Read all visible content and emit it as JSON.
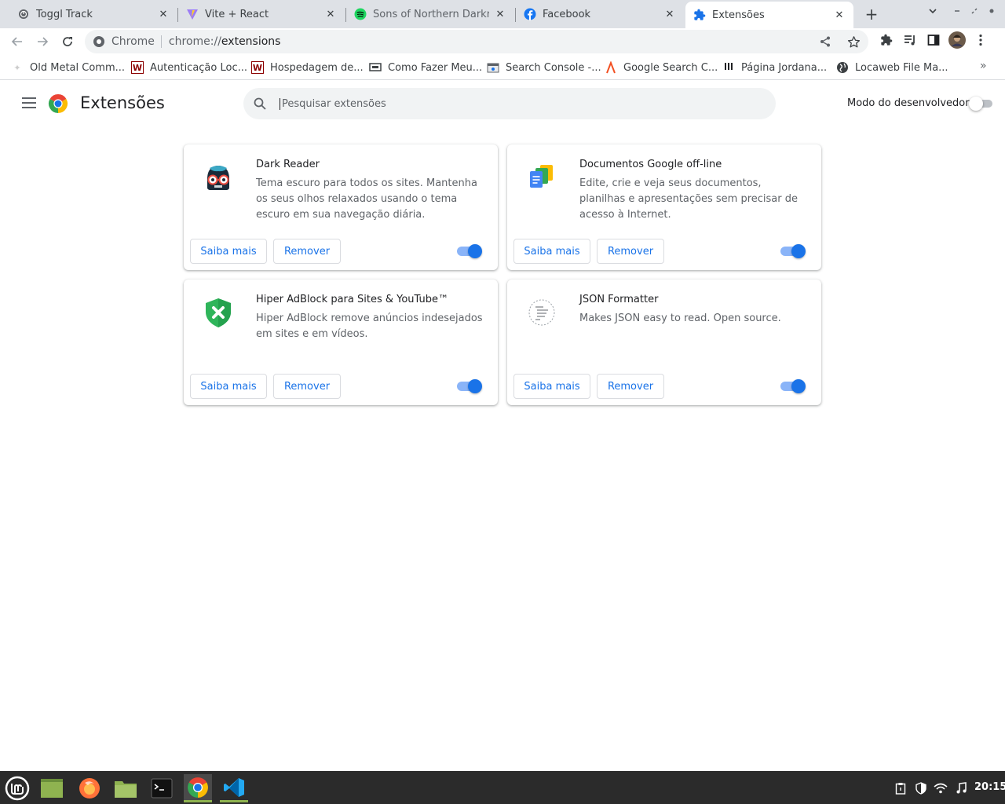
{
  "tabs": [
    {
      "title": "Toggl Track",
      "icon": "toggl-icon"
    },
    {
      "title": "Vite + React",
      "icon": "vite-icon"
    },
    {
      "title": "Sons of Northern Darkness",
      "icon": "spotify-icon"
    },
    {
      "title": "Facebook",
      "icon": "facebook-icon"
    },
    {
      "title": "Extensões",
      "icon": "puzzle-icon",
      "active": true
    }
  ],
  "toolbar": {
    "site_label": "Chrome",
    "url_scheme": "chrome://",
    "url_path": "extensions"
  },
  "bookmarks": [
    {
      "label": "Old Metal Comm...",
      "icon": "metal-icon"
    },
    {
      "label": "Autenticação Loc...",
      "icon": "w-icon"
    },
    {
      "label": "Hospedagem de...",
      "icon": "w-icon"
    },
    {
      "label": "Como Fazer Meu...",
      "icon": "screen-icon"
    },
    {
      "label": "Search Console -...",
      "icon": "search-console-icon"
    },
    {
      "label": "Google Search C...",
      "icon": "lambda-icon"
    },
    {
      "label": "Página Jordana...",
      "icon": "bars-icon"
    },
    {
      "label": "Locaweb File Ma...",
      "icon": "globe-icon"
    }
  ],
  "header": {
    "title": "Extensões",
    "search_placeholder": "Pesquisar extensões",
    "dev_mode_label": "Modo do desenvolvedor",
    "dev_mode_enabled": false
  },
  "extensions": [
    {
      "name": "Dark Reader",
      "description": "Tema escuro para todos os sites. Mantenha os seus olhos relaxados usando o tema escuro em sua navegação diária.",
      "more_label": "Saiba mais",
      "remove_label": "Remover",
      "enabled": true
    },
    {
      "name": "Documentos Google off-line",
      "description": "Edite, crie e veja seus documentos, planilhas e apresentações sem precisar de acesso à Internet.",
      "more_label": "Saiba mais",
      "remove_label": "Remover",
      "enabled": true
    },
    {
      "name": "Hiper AdBlock para Sites & YouTube™",
      "description": "Hiper AdBlock remove anúncios indesejados em sites e em vídeos.",
      "more_label": "Saiba mais",
      "remove_label": "Remover",
      "enabled": true
    },
    {
      "name": "JSON Formatter",
      "description": "Makes JSON easy to read. Open source.",
      "more_label": "Saiba mais",
      "remove_label": "Remover",
      "enabled": true
    }
  ],
  "taskbar": {
    "apps": [
      "mint-menu-icon",
      "desktop-icon",
      "firefox-icon",
      "files-icon",
      "terminal-icon",
      "chrome-icon",
      "vscode-icon"
    ],
    "clock": "20:15"
  },
  "colors": {
    "accent": "#1a73e8",
    "toggle_track": "#8ab4f8",
    "tabstrip": "#dee1e6"
  }
}
